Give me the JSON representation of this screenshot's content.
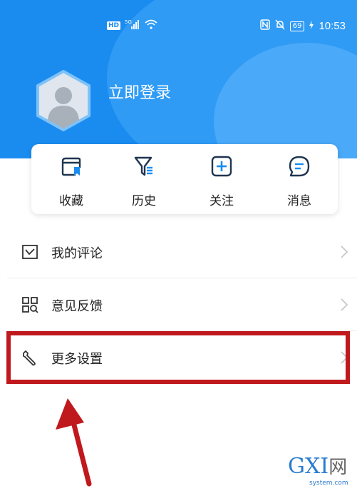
{
  "status_bar": {
    "hd_badge": "HD",
    "network": "5G",
    "battery": "69",
    "time": "10:53"
  },
  "profile": {
    "login_text": "立即登录"
  },
  "quick_actions": [
    {
      "label": "收藏",
      "icon": "bookmark-icon"
    },
    {
      "label": "历史",
      "icon": "history-filter-icon"
    },
    {
      "label": "关注",
      "icon": "add-follow-icon"
    },
    {
      "label": "消息",
      "icon": "message-icon"
    }
  ],
  "menu": [
    {
      "label": "我的评论",
      "icon": "comment-icon"
    },
    {
      "label": "意见反馈",
      "icon": "feedback-grid-icon"
    },
    {
      "label": "更多设置",
      "icon": "wrench-icon"
    }
  ],
  "watermark": {
    "logo": "GXI",
    "logo_cn": "网",
    "domain": "system.com"
  },
  "colors": {
    "header_blue": "#1a8cf0",
    "highlight_red": "#c0191d",
    "arrow_red": "#c0191d"
  }
}
